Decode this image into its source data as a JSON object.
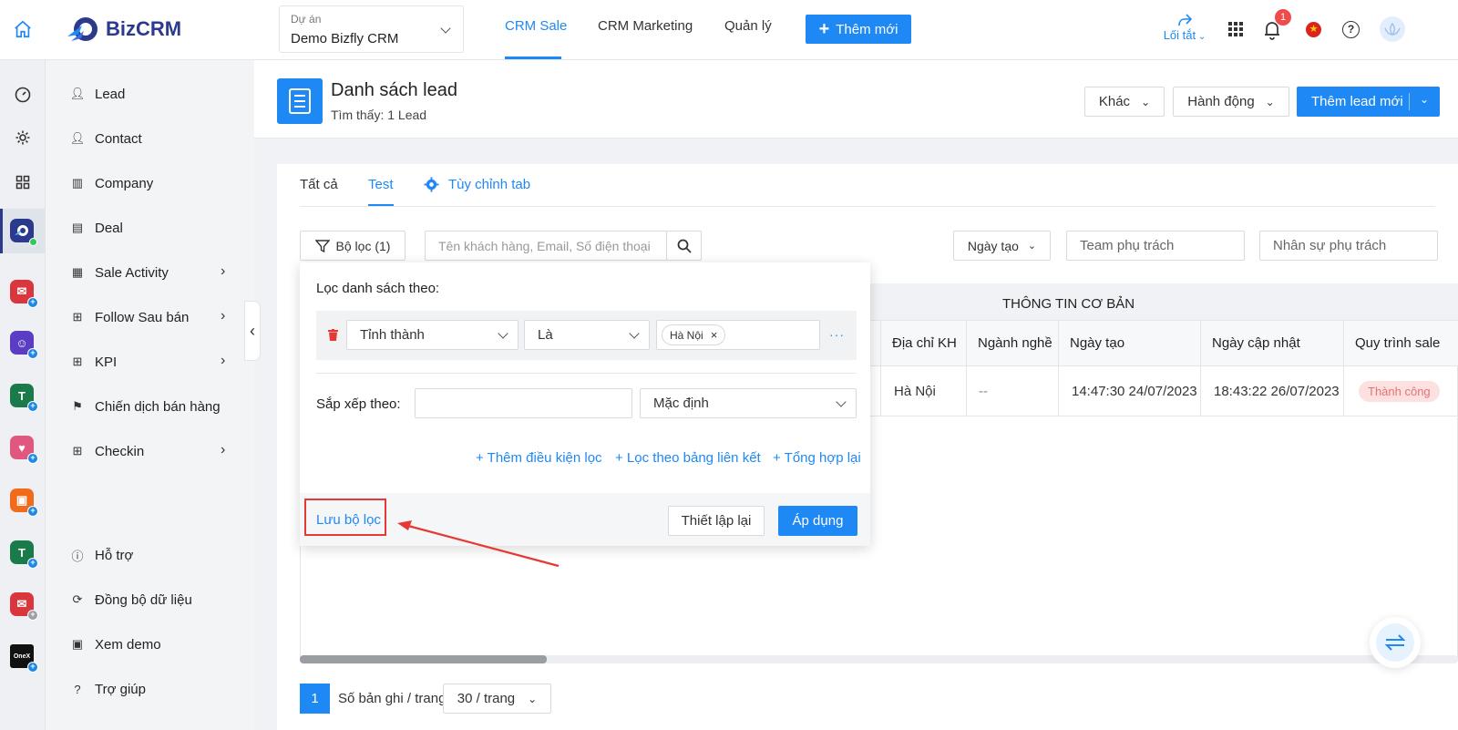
{
  "app": {
    "brand": "BizCRM"
  },
  "header": {
    "project_label": "Dự án",
    "project_value": "Demo Bizfly CRM",
    "tabs": [
      {
        "label": "CRM Sale"
      },
      {
        "label": "CRM Marketing"
      },
      {
        "label": "Quản lý"
      }
    ],
    "add_new_label": "Thêm mới",
    "shortcut_label": "Lối tắt",
    "notification_count": "1"
  },
  "sidebar": {
    "items": [
      {
        "label": "Lead"
      },
      {
        "label": "Contact"
      },
      {
        "label": "Company"
      },
      {
        "label": "Deal"
      },
      {
        "label": "Sale Activity"
      },
      {
        "label": "Follow Sau bán"
      },
      {
        "label": "KPI"
      },
      {
        "label": "Chiến dịch bán hàng"
      },
      {
        "label": "Checkin"
      }
    ],
    "bottom_items": [
      {
        "label": "Hỗ trợ"
      },
      {
        "label": "Đồng bộ dữ liệu"
      },
      {
        "label": "Xem demo"
      },
      {
        "label": "Trợ giúp"
      }
    ]
  },
  "page": {
    "title": "Danh sách lead",
    "subtitle": "Tìm thấy: 1 Lead",
    "other_label": "Khác",
    "action_label": "Hành động",
    "add_lead_label": "Thêm lead mới"
  },
  "tabs": [
    {
      "label": "Tất cả"
    },
    {
      "label": "Test"
    },
    {
      "label": "Tùy chỉnh tab"
    }
  ],
  "toolbar": {
    "filter_label": "Bộ lọc (1)",
    "search_placeholder": "Tên khách hàng, Email, Số điện thoại",
    "date_label": "Ngày tạo",
    "team_placeholder": "Team phụ trách",
    "staff_placeholder": "Nhân sự phụ trách"
  },
  "filter_panel": {
    "heading": "Lọc danh sách theo:",
    "field": "Tỉnh thành",
    "operator": "Là",
    "value_tag": "Hà Nội",
    "more": "···",
    "sort_label": "Sắp xếp theo:",
    "sort_value": "Mặc định",
    "add_condition": "+ Thêm điều kiện lọc",
    "filter_linked": "+ Lọc theo bảng liên kết",
    "aggregate": "+ Tổng hợp lại",
    "save_filter": "Lưu bộ lọc",
    "reset": "Thiết lập lại",
    "apply": "Áp dụng"
  },
  "table": {
    "group_header": "THÔNG TIN CƠ BẢN",
    "columns": [
      "Địa chỉ KH",
      "Ngành nghề",
      "Ngày tạo",
      "Ngày cập nhật",
      "Quy trình sale"
    ],
    "rows": [
      [
        "Hà Nội",
        "--",
        "14:47:30 24/07/2023",
        "18:43:22 26/07/2023",
        "Thành công"
      ]
    ]
  },
  "pagination": {
    "current_page": "1",
    "per_page_label": "Số bản ghi / trang",
    "per_page_value": "30 / trang"
  },
  "colors": {
    "accent": "#1e88f5",
    "highlight_box": "#e53935",
    "status_bg": "#fde0e0",
    "status_text": "#e57373"
  }
}
